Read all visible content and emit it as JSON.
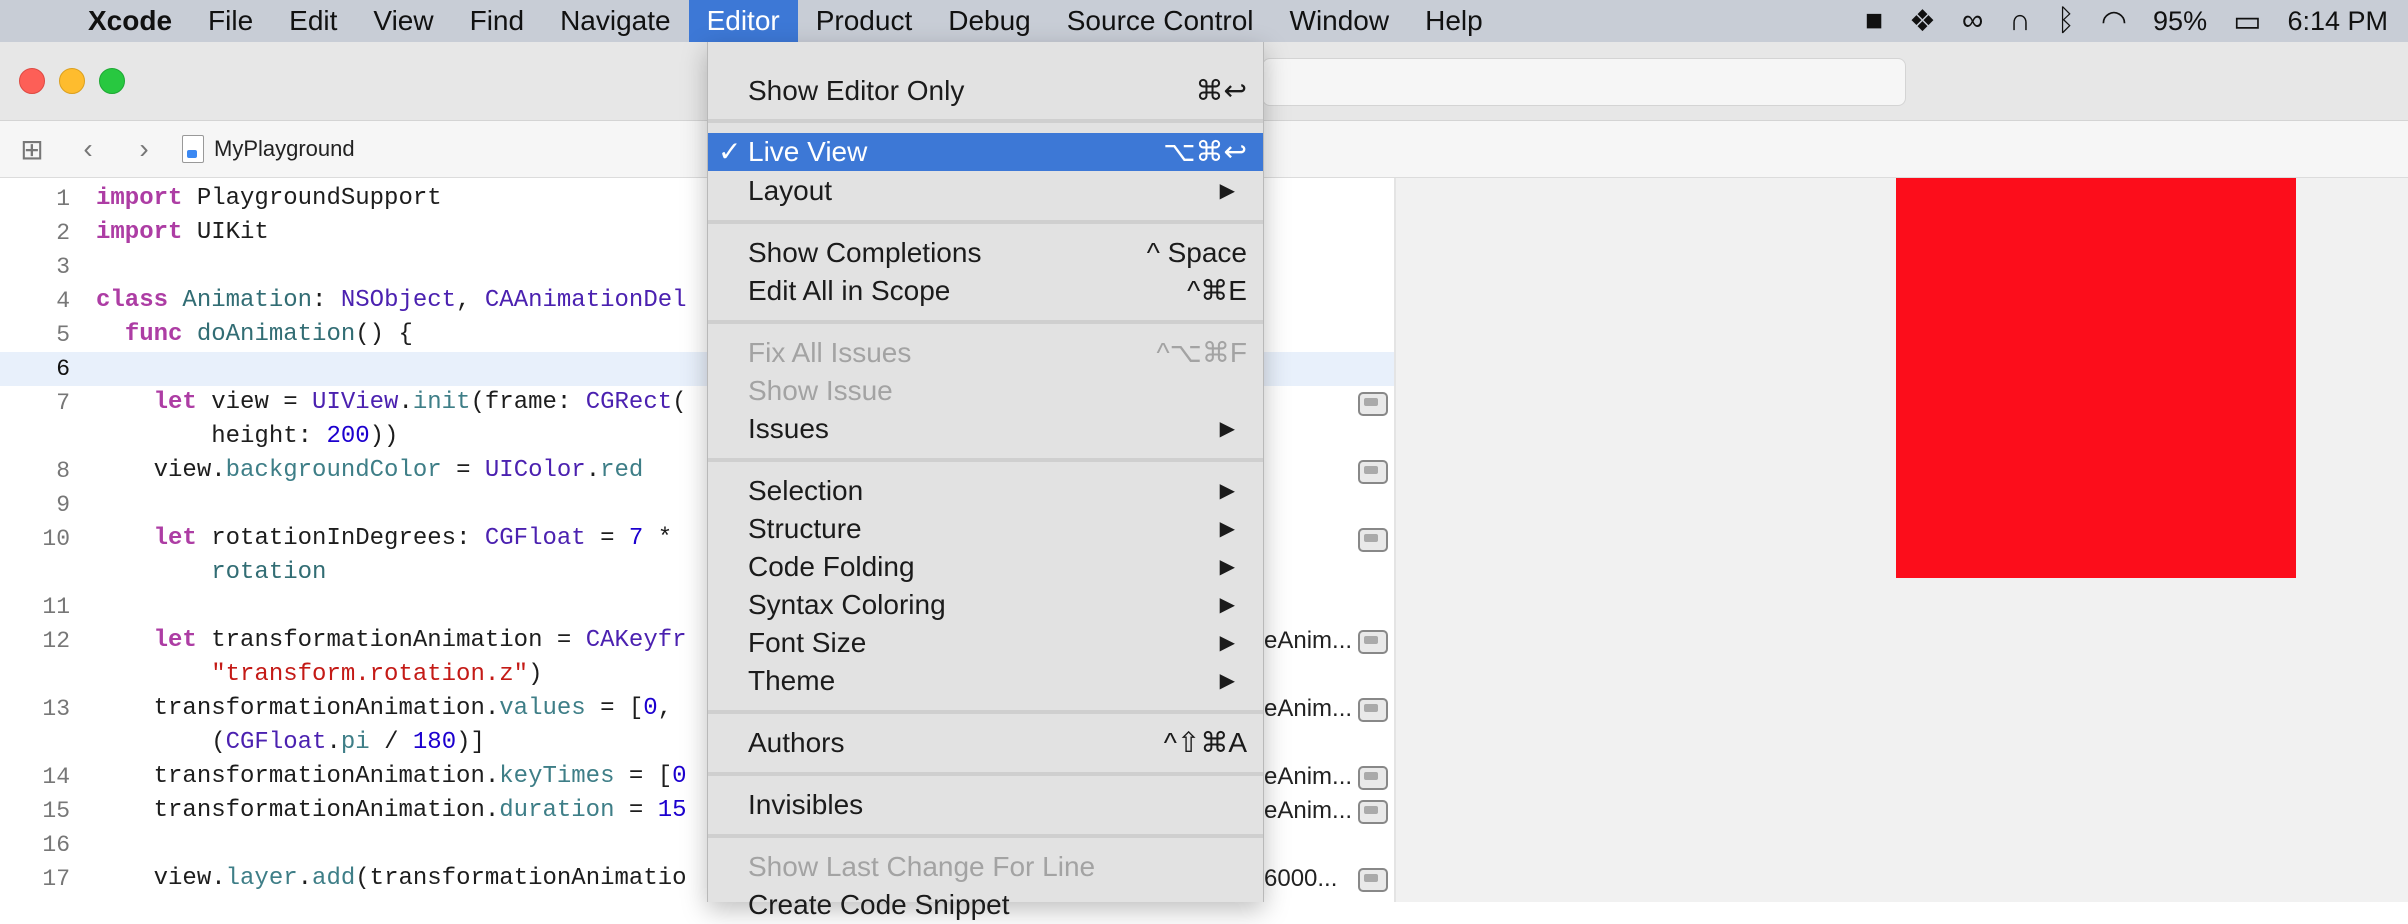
{
  "menubar": {
    "app": "Xcode",
    "items": [
      "File",
      "Edit",
      "View",
      "Find",
      "Navigate",
      "Editor",
      "Product",
      "Debug",
      "Source Control",
      "Window",
      "Help"
    ],
    "battery": "95%",
    "time": "6:14 PM"
  },
  "window": {
    "breadcrumb_file": "MyPlayground"
  },
  "editor_menu": {
    "items": [
      {
        "label": "Show Editor Only",
        "shortcut": "⌘↩"
      },
      {
        "label": "Live View",
        "shortcut": "⌥⌘↩",
        "checked": "✓"
      },
      {
        "label": "Layout"
      },
      {
        "label": "Show Completions",
        "shortcut": "^ Space"
      },
      {
        "label": "Edit All in Scope",
        "shortcut": "^⌘E"
      },
      {
        "label": "Fix All Issues",
        "shortcut": "^⌥⌘F"
      },
      {
        "label": "Show Issue"
      },
      {
        "label": "Issues"
      },
      {
        "label": "Selection"
      },
      {
        "label": "Structure"
      },
      {
        "label": "Code Folding"
      },
      {
        "label": "Syntax Coloring"
      },
      {
        "label": "Font Size"
      },
      {
        "label": "Theme"
      },
      {
        "label": "Authors",
        "shortcut": "^⇧⌘A"
      },
      {
        "label": "Invisibles"
      },
      {
        "label": "Show Last Change For Line"
      },
      {
        "label": "Create Code Snippet"
      }
    ]
  },
  "code": {
    "line_numbers": [
      "1",
      "2",
      "3",
      "4",
      "5",
      "6",
      "7",
      "8",
      "9",
      "10",
      "11",
      "12",
      "13",
      "14",
      "15",
      "16",
      "17"
    ],
    "results": [
      "eAnim...",
      "eAnim...",
      "eAnim...",
      "eAnim...",
      "6000..."
    ]
  }
}
